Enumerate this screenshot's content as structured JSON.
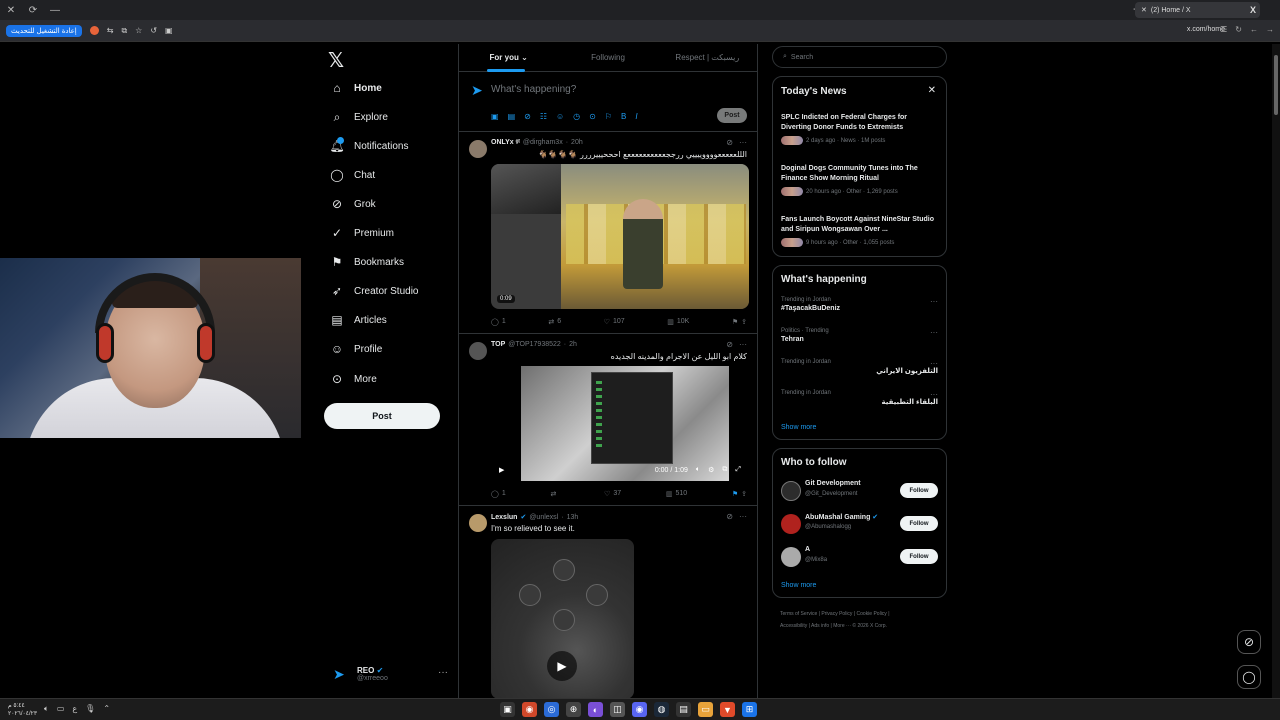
{
  "browser": {
    "tab_title": "(2) Home / X",
    "url": "x.com/home",
    "reload_label": "إعادة التشغيل للتحديث",
    "new_tab": "+",
    "tab_logo": "X"
  },
  "sidebar": {
    "brand": "𝕏",
    "items": [
      {
        "label": "Home",
        "icon": "home-icon"
      },
      {
        "label": "Explore",
        "icon": "search-icon"
      },
      {
        "label": "Notifications",
        "icon": "bell-icon"
      },
      {
        "label": "Chat",
        "icon": "chat-icon"
      },
      {
        "label": "Grok",
        "icon": "grok-icon"
      },
      {
        "label": "Premium",
        "icon": "premium-icon"
      },
      {
        "label": "Bookmarks",
        "icon": "bookmark-icon"
      },
      {
        "label": "Creator Studio",
        "icon": "rocket-icon"
      },
      {
        "label": "Articles",
        "icon": "article-icon"
      },
      {
        "label": "Profile",
        "icon": "person-icon"
      },
      {
        "label": "More",
        "icon": "more-circle-icon"
      }
    ],
    "post_label": "Post",
    "account": {
      "name": "REO",
      "handle": "@xrreeoo"
    }
  },
  "feed": {
    "tabs": [
      "For you",
      "Following",
      "Respect | ريسبكت"
    ],
    "composer_placeholder": "What's happening?",
    "composer_post": "Post",
    "tweets": [
      {
        "name": "ONLYx ᵍᵗ",
        "handle": "@dirgham3x",
        "time": "20h",
        "text": "الللعععععووووييييي ررججععععععععععع احححيييرررر 🐐🐐🐐🐐",
        "video_time": "0:09",
        "replies": "1",
        "reposts": "6",
        "likes": "107",
        "views": "10K"
      },
      {
        "name": "TOP",
        "handle": "@TOP17938522",
        "time": "2h",
        "text": "كلام ابو الليل عن الاجرام والمدينه الجديده",
        "video_time": "0:00 / 1:09",
        "replies": "1",
        "reposts": "",
        "likes": "37",
        "views": "510"
      },
      {
        "name": "Lexslun",
        "handle": "@unlexsl",
        "time": "13h",
        "text": "I'm so relieved to see it."
      }
    ]
  },
  "right": {
    "search_placeholder": "Search",
    "news_title": "Today's News",
    "news": [
      {
        "title": "SPLC Indicted on Federal Charges for Diverting Donor Funds to Extremists",
        "meta": "2 days ago · News · 1M posts"
      },
      {
        "title": "Doginal Dogs Community Tunes into The Finance Show Morning Ritual",
        "meta": "20 hours ago · Other · 1,269 posts"
      },
      {
        "title": "Fans Launch Boycott Against NineStar Studio and Siripun Wongsawan Over ...",
        "meta": "9 hours ago · Other · 1,055 posts"
      }
    ],
    "happening_title": "What's happening",
    "trends": [
      {
        "context": "Trending in Jordan",
        "name": "#TaşacakBuDeniz",
        "rtl": false
      },
      {
        "context": "Politics · Trending",
        "name": "Tehran",
        "rtl": false
      },
      {
        "context": "Trending in Jordan",
        "name": "التلفزيون الايراني",
        "rtl": true
      },
      {
        "context": "Trending in Jordan",
        "name": "البلقاء التطبيقية",
        "rtl": true
      }
    ],
    "show_more": "Show more",
    "wtf_title": "Who to follow",
    "follow": [
      {
        "name": "Git Development",
        "handle": "@Git_Development",
        "verified": false
      },
      {
        "name": "AbuMashal Gaming",
        "handle": "@Abumashalogg",
        "verified": true
      },
      {
        "name": "A",
        "handle": "@Mix8a",
        "verified": false
      }
    ],
    "follow_label": "Follow",
    "footer": [
      "Terms of Service",
      "Privacy Policy",
      "Cookie Policy",
      "Accessibility",
      "Ads info",
      "More ···",
      "© 2026 X Corp."
    ]
  },
  "taskbar": {
    "time": "٥:٤٤ م",
    "date": "٢٠٢٦/٠٤/٢٣",
    "lang": "ع"
  },
  "colors": {
    "accent": "#1d9bf0",
    "background": "#000000",
    "border": "#2f3336"
  }
}
